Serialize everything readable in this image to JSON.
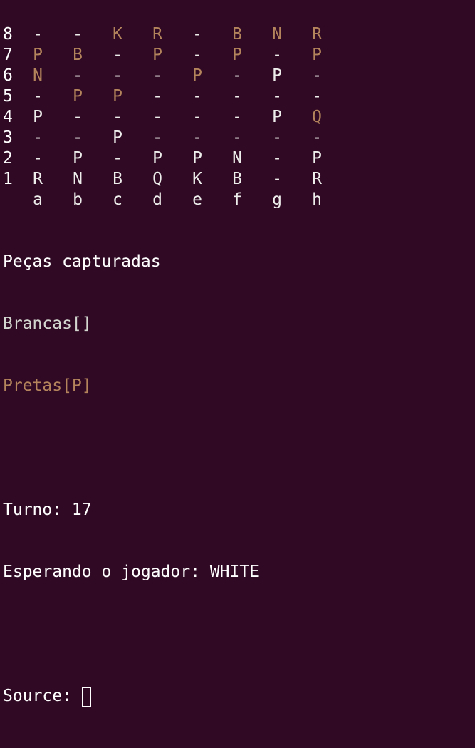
{
  "colors": {
    "background": "#300a24",
    "white_piece": "#eeeeec",
    "black_piece": "#b4845c"
  },
  "board": {
    "rows": [
      {
        "rank": "8",
        "cells": [
          {
            "t": "-",
            "c": "e"
          },
          {
            "t": "-",
            "c": "e"
          },
          {
            "t": "K",
            "c": "b"
          },
          {
            "t": "R",
            "c": "b"
          },
          {
            "t": "-",
            "c": "e"
          },
          {
            "t": "B",
            "c": "b"
          },
          {
            "t": "N",
            "c": "b"
          },
          {
            "t": "R",
            "c": "b"
          }
        ]
      },
      {
        "rank": "7",
        "cells": [
          {
            "t": "P",
            "c": "b"
          },
          {
            "t": "B",
            "c": "b"
          },
          {
            "t": "-",
            "c": "e"
          },
          {
            "t": "P",
            "c": "b"
          },
          {
            "t": "-",
            "c": "e"
          },
          {
            "t": "P",
            "c": "b"
          },
          {
            "t": "-",
            "c": "e"
          },
          {
            "t": "P",
            "c": "b"
          }
        ]
      },
      {
        "rank": "6",
        "cells": [
          {
            "t": "N",
            "c": "b"
          },
          {
            "t": "-",
            "c": "e"
          },
          {
            "t": "-",
            "c": "e"
          },
          {
            "t": "-",
            "c": "e"
          },
          {
            "t": "P",
            "c": "b"
          },
          {
            "t": "-",
            "c": "e"
          },
          {
            "t": "P",
            "c": "w"
          },
          {
            "t": "-",
            "c": "e"
          }
        ]
      },
      {
        "rank": "5",
        "cells": [
          {
            "t": "-",
            "c": "e"
          },
          {
            "t": "P",
            "c": "b"
          },
          {
            "t": "P",
            "c": "b"
          },
          {
            "t": "-",
            "c": "e"
          },
          {
            "t": "-",
            "c": "e"
          },
          {
            "t": "-",
            "c": "e"
          },
          {
            "t": "-",
            "c": "e"
          },
          {
            "t": "-",
            "c": "e"
          }
        ]
      },
      {
        "rank": "4",
        "cells": [
          {
            "t": "P",
            "c": "w"
          },
          {
            "t": "-",
            "c": "e"
          },
          {
            "t": "-",
            "c": "e"
          },
          {
            "t": "-",
            "c": "e"
          },
          {
            "t": "-",
            "c": "e"
          },
          {
            "t": "-",
            "c": "e"
          },
          {
            "t": "P",
            "c": "w"
          },
          {
            "t": "Q",
            "c": "b"
          }
        ]
      },
      {
        "rank": "3",
        "cells": [
          {
            "t": "-",
            "c": "e"
          },
          {
            "t": "-",
            "c": "e"
          },
          {
            "t": "P",
            "c": "w"
          },
          {
            "t": "-",
            "c": "e"
          },
          {
            "t": "-",
            "c": "e"
          },
          {
            "t": "-",
            "c": "e"
          },
          {
            "t": "-",
            "c": "e"
          },
          {
            "t": "-",
            "c": "e"
          }
        ]
      },
      {
        "rank": "2",
        "cells": [
          {
            "t": "-",
            "c": "e"
          },
          {
            "t": "P",
            "c": "w"
          },
          {
            "t": "-",
            "c": "e"
          },
          {
            "t": "P",
            "c": "w"
          },
          {
            "t": "P",
            "c": "w"
          },
          {
            "t": "N",
            "c": "w"
          },
          {
            "t": "-",
            "c": "e"
          },
          {
            "t": "P",
            "c": "w"
          }
        ]
      },
      {
        "rank": "1",
        "cells": [
          {
            "t": "R",
            "c": "w"
          },
          {
            "t": "N",
            "c": "w"
          },
          {
            "t": "B",
            "c": "w"
          },
          {
            "t": "Q",
            "c": "w"
          },
          {
            "t": "K",
            "c": "w"
          },
          {
            "t": "B",
            "c": "w"
          },
          {
            "t": "-",
            "c": "e"
          },
          {
            "t": "R",
            "c": "w"
          }
        ]
      }
    ],
    "files": [
      "a",
      "b",
      "c",
      "d",
      "e",
      "f",
      "g",
      "h"
    ]
  },
  "info": {
    "captured_heading": "Peças capturadas",
    "captured_white": "Brancas[]",
    "captured_black": "Pretas[P]",
    "turn": "Turno: 17",
    "waiting": "Esperando o jogador: WHITE",
    "prompt": "Source:"
  }
}
